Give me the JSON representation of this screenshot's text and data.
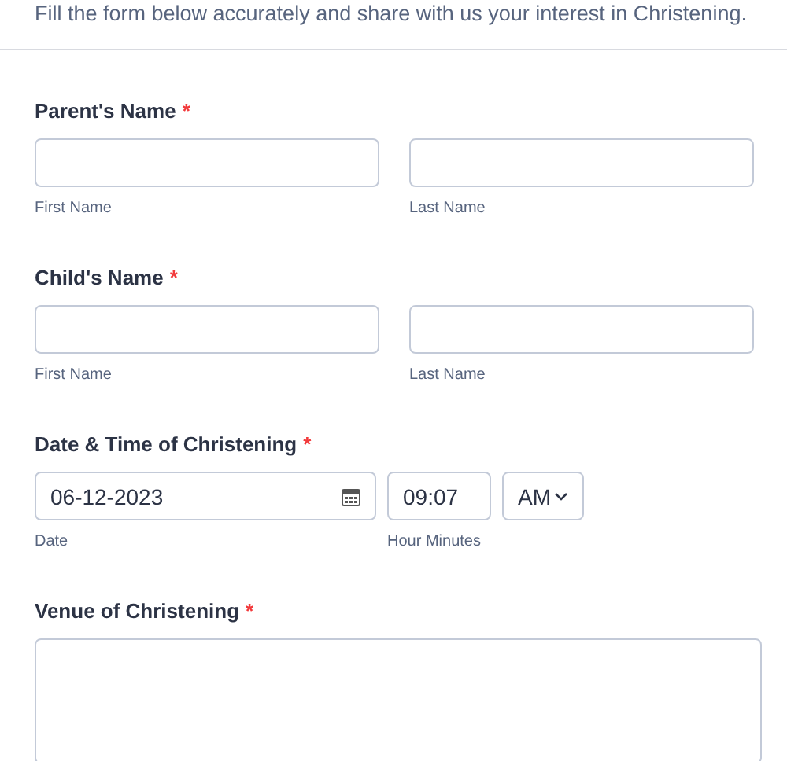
{
  "intro": "Fill the form below accurately and share with us your interest in Christening.",
  "fields": [
    {
      "kind": "name",
      "label": "Parent's Name",
      "required_mark": "*",
      "sublabels": [
        "First Name",
        "Last Name"
      ]
    },
    {
      "kind": "name",
      "label": "Child's Name",
      "required_mark": "*",
      "sublabels": [
        "First Name",
        "Last Name"
      ]
    },
    {
      "kind": "datetime",
      "label": "Date & Time of Christening",
      "required_mark": "*",
      "date": "06-12-2023",
      "time": "09:07",
      "ampm": "AM",
      "sublabels": [
        "Date",
        "Hour Minutes"
      ]
    },
    {
      "kind": "textarea",
      "label": "Venue of Christening",
      "required_mark": "*"
    }
  ]
}
